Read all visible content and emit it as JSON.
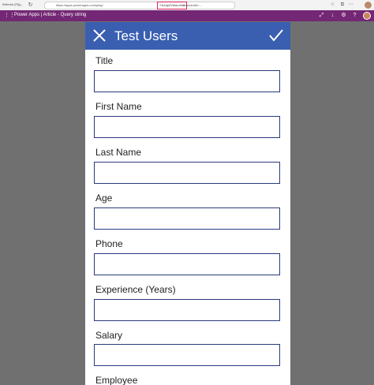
{
  "browser": {
    "tab_label": "Refresh (F5)",
    "url_prefix": "https://apps.powerapps.com/play/",
    "url_highlight": "?Jump2View=Alle",
    "url_suffix": "&tenantId=..."
  },
  "app_header": {
    "title": "Power Apps  |  Article - Query string"
  },
  "form": {
    "title": "Test Users",
    "fields": [
      {
        "label": "Title",
        "value": ""
      },
      {
        "label": "First Name",
        "value": ""
      },
      {
        "label": "Last Name",
        "value": ""
      },
      {
        "label": "Age",
        "value": ""
      },
      {
        "label": "Phone",
        "value": ""
      },
      {
        "label": "Experience (Years)",
        "value": ""
      },
      {
        "label": "Salary",
        "value": ""
      },
      {
        "label": "Employee",
        "value": ""
      }
    ]
  },
  "colors": {
    "background": "#707070",
    "app_header": "#742774",
    "form_header": "#3a5fb1",
    "input_border": "#2b3a7a"
  }
}
